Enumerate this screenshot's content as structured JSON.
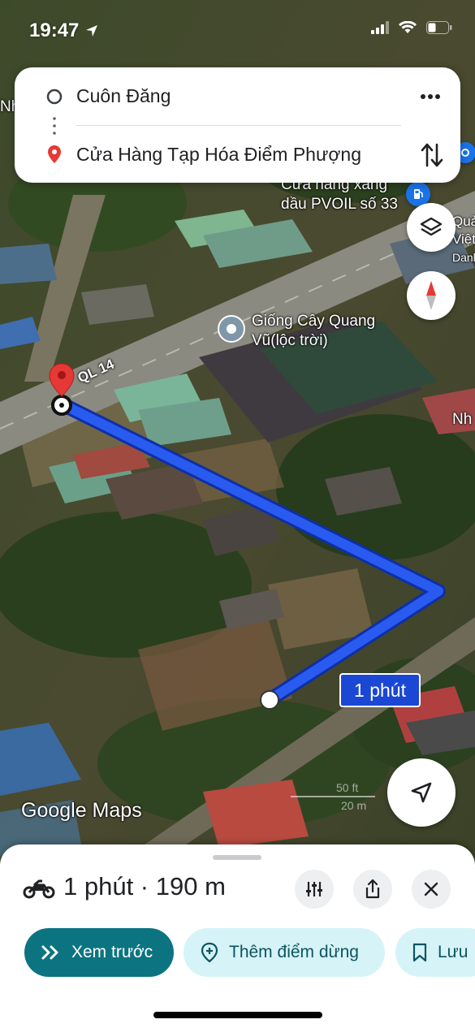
{
  "status": {
    "time": "19:47"
  },
  "route": {
    "origin": "Cuôn Đăng",
    "destination": "Cửa Hàng Tạp Hóa Điểm Phượng"
  },
  "map": {
    "labels": {
      "gas_station_line1": "Cửa hàng xăng",
      "gas_station_line2": "dầu PVOIL số 33",
      "place_line1": "Giống Cây Quang",
      "place_line2": "Vũ(lộc trời)",
      "road": "QL 14",
      "edge_left": "Nh",
      "edge_right": "Nh",
      "edge_top_right_1": "Quả",
      "edge_top_right_2": "Việt",
      "edge_top_right_3": "Danh"
    },
    "duration_badge": "1 phút",
    "attribution": "Google Maps",
    "scale_ft": "50 ft",
    "scale_m": "20 m"
  },
  "sheet": {
    "summary": "1 phút · 190 m",
    "buttons": {
      "preview": "Xem trước",
      "add_stop": "Thêm điểm dừng",
      "save": "Lưu"
    }
  },
  "colors": {
    "route": "#1a47d4",
    "preview_bg": "#0c7481",
    "pill_bg": "#d6f3f8"
  }
}
